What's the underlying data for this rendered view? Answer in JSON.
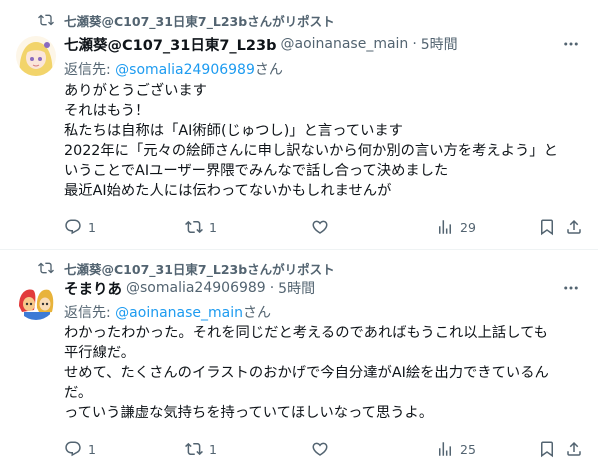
{
  "tweets": [
    {
      "repost_label": "七瀬葵@C107_31日東7_L23bさんがリポスト",
      "name": "七瀬葵@C107_31日東7_L23b",
      "handle": "@aoinanase_main",
      "dot": "·",
      "time": "5時間",
      "reply_prefix": "返信先: ",
      "reply_mention": "@somalia24906989",
      "reply_suffix": "さん",
      "lines": [
        "ありがとうございます",
        "それはもう！",
        "私たちは自称は「AI術師(じゅつし)」と言っています",
        "2022年に「元々の絵師さんに申し訳ないから何か別の言い方を考えよう」と",
        "いうことでAIユーザー界隈でみんなで話し合って決めました",
        "最近AI始めた人には伝わってないかもしれませんが"
      ],
      "actions": {
        "reply_count": "1",
        "repost_count": "1",
        "like_count": "",
        "views_count": "29"
      },
      "avatar_colors": {
        "hair": "#f2d46b",
        "skin": "#fbe6da",
        "accent": "#8a6bbf"
      }
    },
    {
      "repost_label": "七瀬葵@C107_31日東7_L23bさんがリポスト",
      "name": "そまりあ",
      "handle": "@somalia24906989",
      "dot": "·",
      "time": "5時間",
      "reply_prefix": "返信先: ",
      "reply_mention": "@aoinanase_main",
      "reply_suffix": "さん",
      "lines": [
        "わかったわかった。それを同じだと考えるのであればもうこれ以上話しても",
        "平行線だ。",
        "せめて、たくさんのイラストのおかげで今自分達がAI絵を出力できているん",
        "だ。",
        "っていう謙虚な気持ちを持っていてほしいなって思うよ。"
      ],
      "actions": {
        "reply_count": "1",
        "repost_count": "1",
        "like_count": "",
        "views_count": "25"
      },
      "avatar_colors": {
        "hair": "#e23b3b",
        "skin": "#f7c98b",
        "accent": "#e8b33a"
      }
    }
  ],
  "colors": {
    "text": "#0f1419",
    "secondary": "#536471",
    "link": "#1d9bf0",
    "divider": "#eff3f4"
  }
}
